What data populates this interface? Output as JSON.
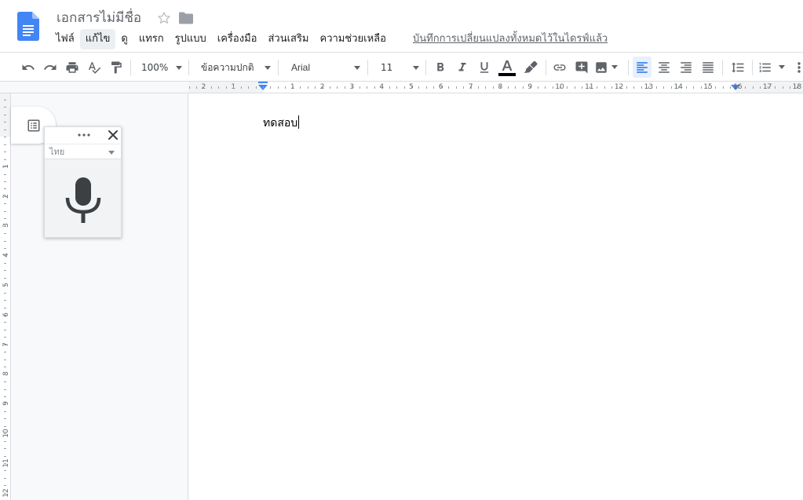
{
  "header": {
    "title": "เอกสารไม่มีชื่อ",
    "save_status": "บันทึกการเปลี่ยนแปลงทั้งหมดไว้ในไดรฟ์แล้ว",
    "menu": [
      {
        "label": "ไฟล์",
        "active": false
      },
      {
        "label": "แก้ไข",
        "active": true
      },
      {
        "label": "ดู",
        "active": false
      },
      {
        "label": "แทรก",
        "active": false
      },
      {
        "label": "รูปแบบ",
        "active": false
      },
      {
        "label": "เครื่องมือ",
        "active": false
      },
      {
        "label": "ส่วนเสริม",
        "active": false
      },
      {
        "label": "ความช่วยเหลือ",
        "active": false
      }
    ]
  },
  "toolbar": {
    "zoom": "100%",
    "style": "ข้อความปกติ",
    "font": "Arial",
    "font_size": "11",
    "text_color": "#000000",
    "accent_color": "#1a73e8"
  },
  "ruler": {
    "horizontal_labels": [
      "2",
      "1",
      "1",
      "2",
      "3",
      "4",
      "5",
      "6",
      "7",
      "8",
      "9",
      "10",
      "11",
      "12",
      "13",
      "14",
      "15",
      "16",
      "17",
      "18"
    ],
    "vertical_labels": [
      "1",
      "2",
      "3",
      "4",
      "5",
      "6",
      "7",
      "8",
      "9",
      "10",
      "11",
      "12"
    ]
  },
  "document": {
    "text": "ทดสอบ"
  },
  "voice_typing": {
    "language": "ไทย"
  },
  "colors": {
    "brand_blue": "#4285f4",
    "icon_gray": "#5f6368",
    "page_bg": "#f8f9fa"
  }
}
